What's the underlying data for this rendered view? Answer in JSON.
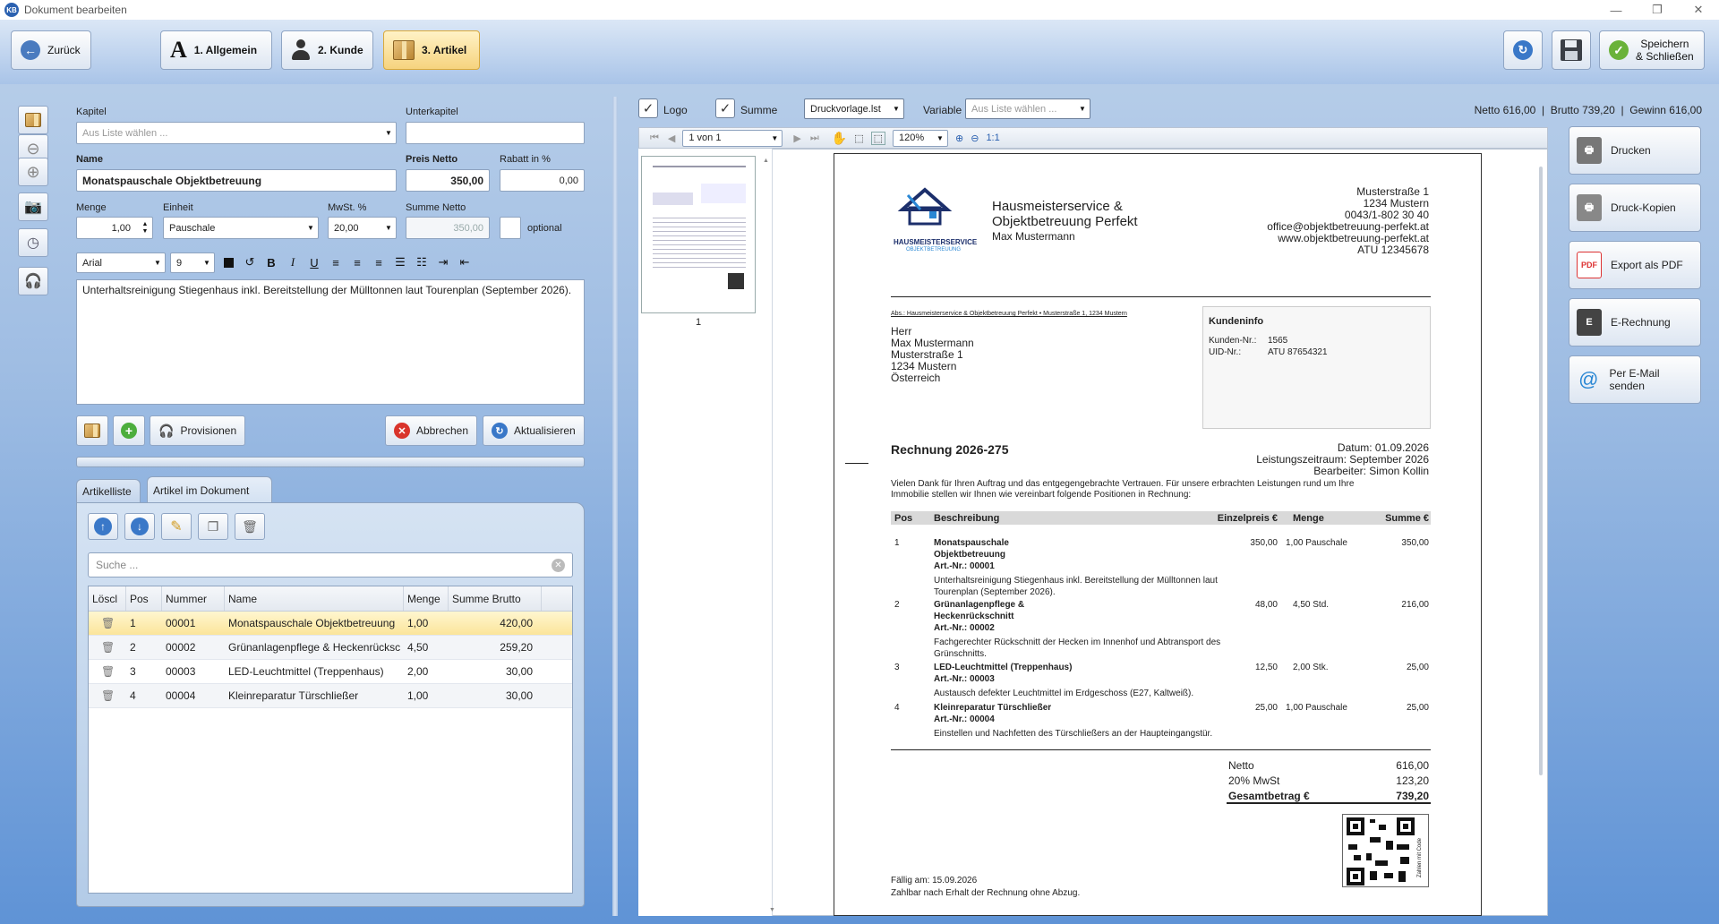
{
  "window": {
    "title": "Dokument bearbeiten",
    "app_badge": "KB"
  },
  "toolbar": {
    "back_label": "Zurück",
    "step1_label": "1. Allgemein",
    "step2_label": "2. Kunde",
    "step3_label": "3. Artikel",
    "save_close_line1": "Speichern",
    "save_close_line2": "& Schließen"
  },
  "form": {
    "kapitel_label": "Kapitel",
    "kapitel_placeholder": "Aus Liste wählen ...",
    "unterkapitel_label": "Unterkapitel",
    "unterkapitel_value": "",
    "name_label": "Name",
    "name_value": "Monatspauschale Objektbetreuung",
    "preis_label": "Preis Netto",
    "preis_value": "350,00",
    "rabatt_label": "Rabatt in %",
    "rabatt_value": "0,00",
    "menge_label": "Menge",
    "menge_value": "1,00",
    "einheit_label": "Einheit",
    "einheit_value": "Pauschale",
    "mwst_label": "MwSt. %",
    "mwst_value": "20,00",
    "summe_label": "Summe Netto",
    "summe_value": "350,00",
    "optional_label": "optional",
    "font_value": "Arial",
    "fontsize_value": "9",
    "description": "Unterhaltsreinigung Stiegenhaus inkl. Bereitstellung der Mülltonnen laut Tourenplan (September 2026)."
  },
  "actions": {
    "provisionen_label": "Provisionen",
    "abbrechen_label": "Abbrechen",
    "aktualisieren_label": "Aktualisieren"
  },
  "tabs": {
    "artikelliste": "Artikelliste",
    "im_dokument": "Artikel im Dokument"
  },
  "list": {
    "search_placeholder": "Suche ...",
    "columns": [
      "Löscl",
      "Pos",
      "Nummer",
      "Name",
      "Menge",
      "Summe Brutto"
    ],
    "rows": [
      {
        "pos": "1",
        "nummer": "00001",
        "name": "Monatspauschale Objektbetreuung",
        "menge": "1,00",
        "summe": "420,00"
      },
      {
        "pos": "2",
        "nummer": "00002",
        "name": "Grünanlagenpflege & Heckenrücksc",
        "menge": "4,50",
        "summe": "259,20"
      },
      {
        "pos": "3",
        "nummer": "00003",
        "name": "LED-Leuchtmittel (Treppenhaus)",
        "menge": "2,00",
        "summe": "30,00"
      },
      {
        "pos": "4",
        "nummer": "00004",
        "name": "Kleinreparatur Türschließer",
        "menge": "1,00",
        "summe": "30,00"
      }
    ]
  },
  "preview_opts": {
    "logo_label": "Logo",
    "summe_label": "Summe",
    "template_value": "Druckvorlage.lst",
    "variable_label": "Variable",
    "variable_placeholder": "Aus Liste wählen ...",
    "totals_summary": "Netto 616,00  |  Brutto 739,20  |  Gewinn 616,00",
    "page_value": "1 von 1",
    "zoom_value": "120%",
    "zoom_11": "1:1",
    "thumb_page_no": "1"
  },
  "invoice": {
    "company_line1": "Hausmeisterservice &",
    "company_line2": "Objektbetreuung Perfekt",
    "company_owner": "Max Mustermann",
    "logo_text": "HAUSMEISTERSERVICE",
    "logo_sub": "OBJEKTBETREUUNG",
    "addr": [
      "Musterstraße 1",
      "1234 Mustern",
      "0043/1-802 30 40",
      "office@objektbetreuung-perfekt.at",
      "www.objektbetreuung-perfekt.at",
      "ATU 12345678"
    ],
    "sender_line": "Abs.: Hausmeisterservice & Objektbetreuung Perfekt • Musterstraße 1, 1234 Mustern",
    "recipient": [
      "Herr",
      "Max Mustermann",
      "Musterstraße 1",
      "1234 Mustern",
      "Österreich"
    ],
    "kundeninfo_title": "Kundeninfo",
    "kunden_nr_label": "Kunden-Nr.:",
    "kunden_nr": "1565",
    "uid_label": "UID-Nr.:",
    "uid": "ATU 87654321",
    "title": "Rechnung 2026-275",
    "datum": "Datum: 01.09.2026",
    "zeitraum": "Leistungszeitraum: September 2026",
    "bearbeiter": "Bearbeiter: Simon Kollin",
    "intro1": "Vielen Dank für Ihren Auftrag und das entgegengebrachte Vertrauen. Für unsere erbrachten Leistungen rund um Ihre",
    "intro2": "Immobilie stellen wir Ihnen wie vereinbart folgende Positionen in Rechnung:",
    "th": [
      "Pos",
      "Beschreibung",
      "Einzelpreis €",
      "Menge",
      "Summe €"
    ],
    "items": [
      {
        "pos": "1",
        "l1": "Monatspauschale",
        "l2": "Objektbetreuung",
        "art": "Art.-Nr.: 00001",
        "d1": "Unterhaltsreinigung Stiegenhaus inkl. Bereitstellung der Mülltonnen laut",
        "d2": "Tourenplan (September 2026).",
        "preis": "350,00",
        "menge": "1,00 Pauschale",
        "summe": "350,00"
      },
      {
        "pos": "2",
        "l1": "Grünanlagenpflege &",
        "l2": "Heckenrückschnitt",
        "art": "Art.-Nr.: 00002",
        "d1": "Fachgerechter Rückschnitt der Hecken im Innenhof und Abtransport des",
        "d2": "Grünschnitts.",
        "preis": "48,00",
        "menge": "4,50 Std.",
        "summe": "216,00"
      },
      {
        "pos": "3",
        "l1": "LED-Leuchtmittel (Treppenhaus)",
        "l2": "",
        "art": "Art.-Nr.: 00003",
        "d1": "Austausch defekter Leuchtmittel im Erdgeschoss (E27, Kaltweiß).",
        "d2": "",
        "preis": "12,50",
        "menge": "2,00 Stk.",
        "summe": "25,00"
      },
      {
        "pos": "4",
        "l1": "Kleinreparatur Türschließer",
        "l2": "",
        "art": "Art.-Nr.: 00004",
        "d1": "Einstellen und Nachfetten des Türschließers an der Haupteingangstür.",
        "d2": "",
        "preis": "25,00",
        "menge": "1,00 Pauschale",
        "summe": "25,00"
      }
    ],
    "netto_label": "Netto",
    "netto": "616,00",
    "mwst_label": "20% MwSt",
    "mwst": "123,20",
    "gesamt_label": "Gesamtbetrag €",
    "gesamt": "739,20",
    "qr_caption": "Zahlen mit Code",
    "faellig": "Fällig am: 15.09.2026",
    "zahlbar": "Zahlbar nach Erhalt der Rechnung ohne Abzug."
  },
  "right_actions": {
    "drucken": "Drucken",
    "kopien": "Druck-Kopien",
    "pdf": "Export als PDF",
    "pdf_badge": "PDF",
    "erechnung": "E-Rechnung",
    "email": "Per E-Mail senden"
  }
}
